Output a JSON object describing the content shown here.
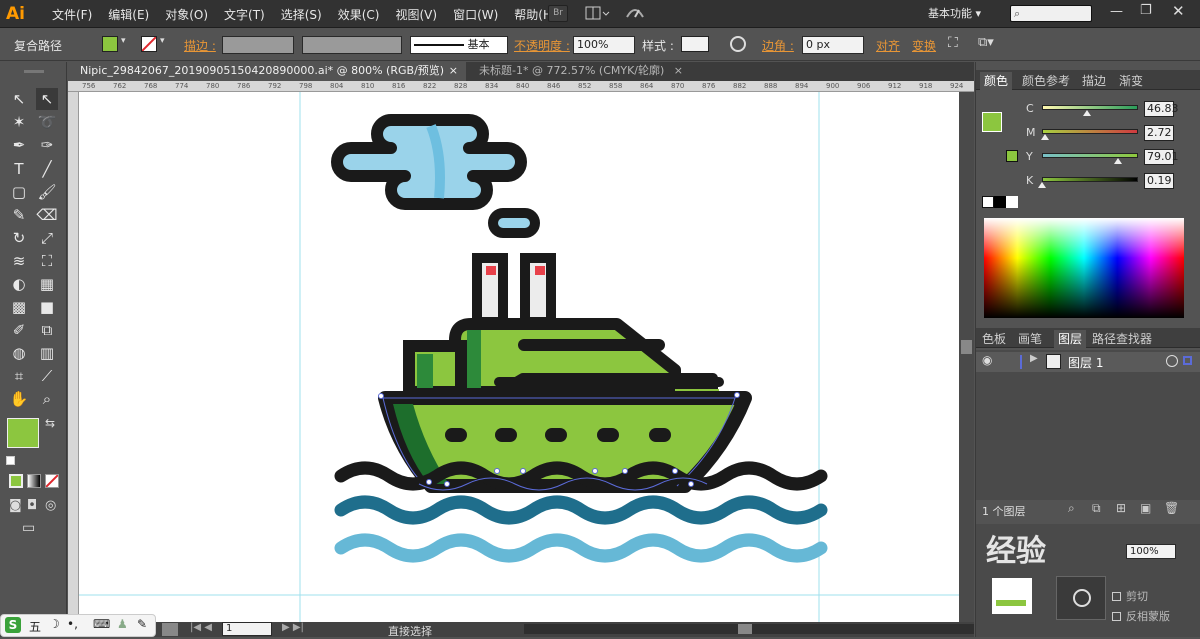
{
  "app": {
    "logo": "Ai"
  },
  "menu": [
    "文件(F)",
    "编辑(E)",
    "对象(O)",
    "文字(T)",
    "选择(S)",
    "效果(C)",
    "视图(V)",
    "窗口(W)",
    "帮助(H)"
  ],
  "menu_br": "Br",
  "workspace": "基本功能",
  "control": {
    "selection_type": "复合路径",
    "stroke_label": "描边 :",
    "stroke_profile": "基本",
    "opacity_label": "不透明度 :",
    "opacity_value": "100%",
    "style_label": "样式 :",
    "corner_label": "边角 :",
    "corner_value": "0 px",
    "align_label": "对齐",
    "transform_label": "变换",
    "fill_color": "#8cc63f"
  },
  "tabs": [
    {
      "label": "Nipic_29842067_20190905150420890000.ai* @ 800% (RGB/预览)",
      "close": "×"
    },
    {
      "label": "未标题-1* @ 772.57% (CMYK/轮廓)",
      "close": "×"
    }
  ],
  "ruler_ticks": [
    "756",
    "762",
    "768",
    "774",
    "780",
    "786",
    "792",
    "798",
    "804",
    "810",
    "816",
    "822",
    "828",
    "834",
    "840",
    "846",
    "852",
    "858",
    "864",
    "870",
    "876",
    "882",
    "888",
    "894",
    "900",
    "906",
    "912",
    "918",
    "924"
  ],
  "color_panel": {
    "tabs": [
      "颜色",
      "颜色参考",
      "描边",
      "渐变"
    ],
    "channels": [
      {
        "name": "C",
        "value": "46.83",
        "level": 0.468
      },
      {
        "name": "M",
        "value": "2.72",
        "level": 0.027
      },
      {
        "name": "Y",
        "value": "79.01",
        "level": 0.79
      },
      {
        "name": "K",
        "value": "0.19",
        "level": 0.002
      }
    ]
  },
  "layers_panel": {
    "tabs": [
      "色板",
      "画笔",
      "图层",
      "路径查找器"
    ],
    "layer_name": "图层 1",
    "count": "1 个图层"
  },
  "transparency_panel": {
    "opacity": "100%",
    "options": [
      "剪切",
      "反相蒙版"
    ]
  },
  "watermark": "经验",
  "status": {
    "zoom": "1",
    "tool": "直接选择"
  },
  "taskbar": {
    "ime": "五"
  },
  "illustration": {
    "colors": {
      "outline": "#1a1a1a",
      "cloud": "#9ad3ea",
      "cloud_shadow": "#6ebfe0",
      "hull": "#8cc63f",
      "hull_dark": "#1d6e2c",
      "cabin_dark": "#2d8a3a",
      "deck_orange": "#f05a1e",
      "chimney_top": "#e8414a",
      "chimney": "#ececec",
      "wave_mid": "#1f6e8c",
      "wave_light": "#66b8d6",
      "selection": "#5b6bd8"
    }
  }
}
